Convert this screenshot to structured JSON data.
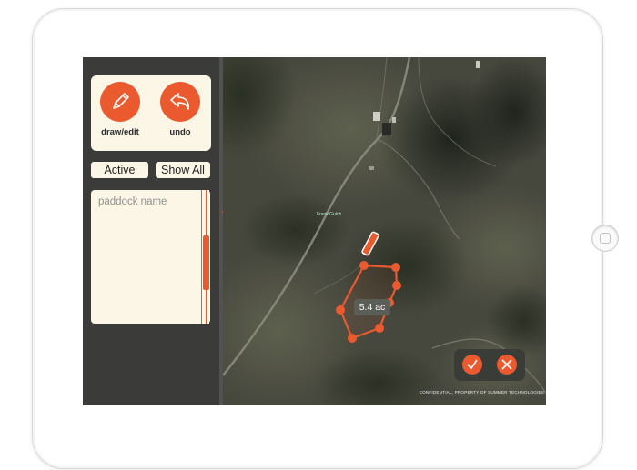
{
  "toolbar": {
    "draw_label": "draw/edit",
    "undo_label": "undo"
  },
  "filters": {
    "active_label": "Active",
    "show_all_label": "Show All"
  },
  "paddock_list": {
    "placeholder": "paddock name"
  },
  "map": {
    "area_label": "5.4 ac",
    "place_label": "Frank Gulch",
    "confidential_text": "CONFIDENTIAL, PROPERTY OF SUMMER TECHNOLOGIES"
  },
  "icons": {
    "draw": "pencil-icon",
    "undo": "undo-arrow-icon",
    "confirm": "checkmark-icon",
    "cancel": "close-icon",
    "collapse": "chevron-left-icon",
    "edit_marker": "pencil-marker-icon"
  },
  "colors": {
    "accent": "#ea5a2e",
    "panel_bg": "#fbf6e6",
    "sidebar_bg": "#3b3b3a"
  }
}
